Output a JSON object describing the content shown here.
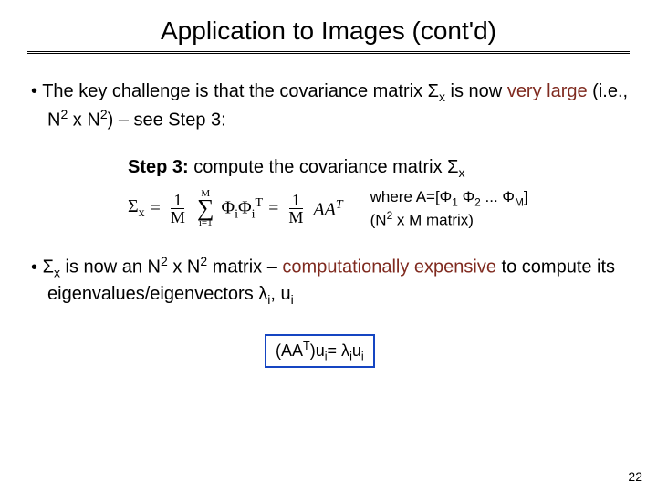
{
  "title": "Application to Images (cont'd)",
  "bullet1": {
    "pre": "The key challenge is that the covariance matrix Σ",
    "sub1": "x",
    "mid": " is now ",
    "accent": "very large",
    "post1": " (i.e., N",
    "sup1": "2",
    "post2": " x N",
    "sup2": "2",
    "post3": ") – see Step 3:"
  },
  "step3": {
    "label": "Step 3:",
    "text": " compute the covariance matrix Σ",
    "sub": "x"
  },
  "eq": {
    "lhs": "Σ",
    "lhs_sub": "x",
    "eq1": " = ",
    "frac1_num": "1",
    "frac1_den": "M",
    "sum_top": "M",
    "sum_bot": "i=1",
    "phi": "Φ",
    "phi_sub": "i",
    "phiT": "Φ",
    "phiT_sub": "i",
    "phiT_sup": "T",
    "eq2": " = ",
    "frac2_num": "1",
    "frac2_den": "M",
    "aat": "AA",
    "aat_sup": "T"
  },
  "eq_note": {
    "line1_pre": "where A=[Φ",
    "s1": "1",
    "mid1": " Φ",
    "s2": "2",
    "mid2": " ... Φ",
    "sM": "M",
    "line1_post": "]",
    "line2_pre": "(N",
    "sup": "2",
    "line2_post": " x M matrix)"
  },
  "bullet2": {
    "pre": "Σ",
    "sub1": "x",
    "mid1": " is now an N",
    "sup1": "2",
    "mid2": " x N",
    "sup2": "2",
    "mid3": " matrix – ",
    "accent": "computationally expensive",
    "post1": " to compute its eigenvalues/eigenvectors λ",
    "sub2": "i",
    "post2": ", u",
    "sub3": "i"
  },
  "boxed": {
    "pre": "(AA",
    "supT": "T",
    "mid1": ")u",
    "sub1": "i",
    "mid2": "= λ",
    "sub2": "i",
    "mid3": "u",
    "sub3": "i"
  },
  "pagenum": "22"
}
